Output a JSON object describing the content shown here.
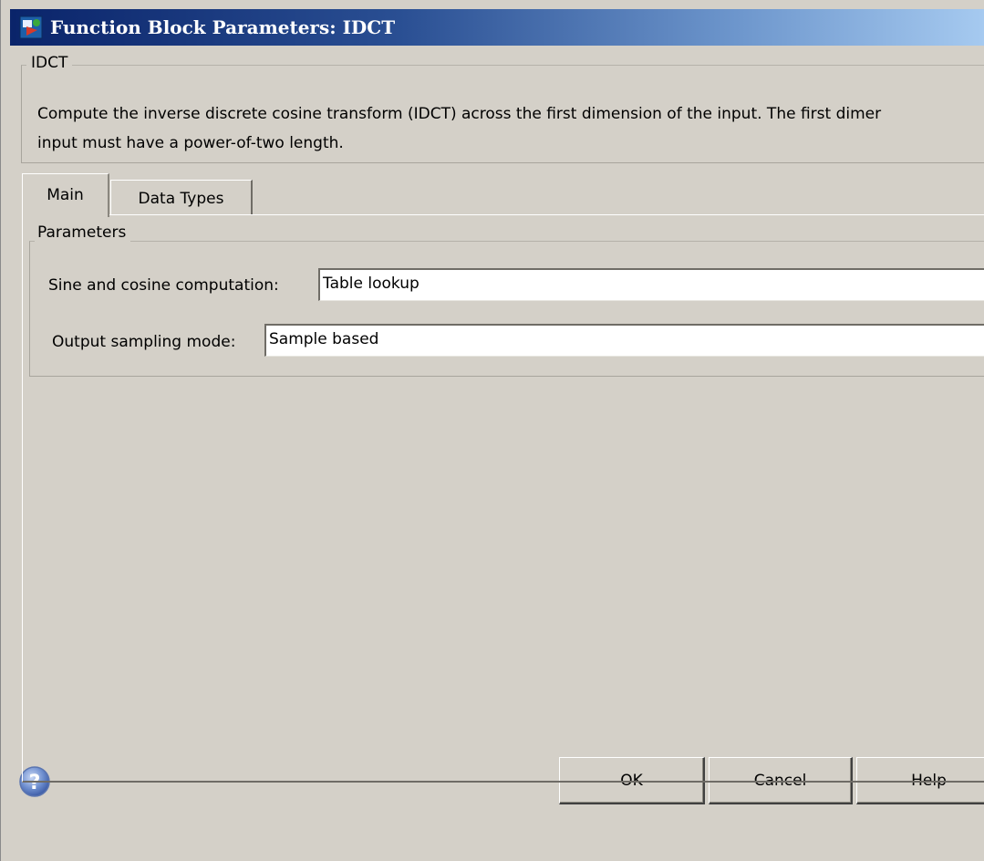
{
  "window": {
    "title": "Function Block Parameters: IDCT"
  },
  "description": {
    "group_title": "IDCT",
    "text_line1": "Compute the inverse discrete cosine transform (IDCT) across the first dimension of the input. The first dimer",
    "text_line2": "input must have a power-of-two length."
  },
  "tabs": [
    {
      "label": "Main",
      "selected": true
    },
    {
      "label": "Data Types",
      "selected": false
    }
  ],
  "parameters": {
    "group_title": "Parameters",
    "sine_cosine": {
      "label": "Sine and cosine computation:",
      "value": "Table lookup"
    },
    "output_sampling": {
      "label": "Output sampling mode:",
      "value": "Sample based"
    }
  },
  "buttons": {
    "ok": "OK",
    "cancel": "Cancel",
    "help": "Help"
  },
  "icons": {
    "title_icon": "simulink-block-icon",
    "help_icon": "question-mark-icon"
  }
}
